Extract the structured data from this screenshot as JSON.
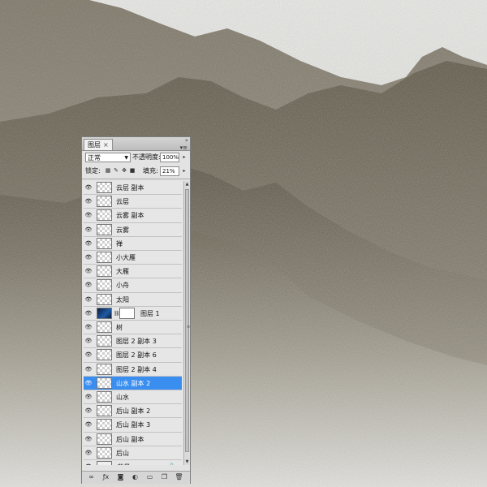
{
  "panel": {
    "tab_label": "图层",
    "tab_close": "×",
    "collapse_icon": "»",
    "menu_icon": "▾≡",
    "blend_mode": "正常",
    "opacity_label": "不透明度:",
    "opacity_value": "100%",
    "lock_label": "锁定:",
    "fill_label": "填充:",
    "fill_value": "21%"
  },
  "layers": [
    {
      "name": "云层 副本",
      "thumb": "checker"
    },
    {
      "name": "云层",
      "thumb": "checker"
    },
    {
      "name": "云雾 副本",
      "thumb": "checker"
    },
    {
      "name": "云雾",
      "thumb": "checker"
    },
    {
      "name": "禅",
      "thumb": "checker"
    },
    {
      "name": "小大雁",
      "thumb": "checker"
    },
    {
      "name": "大雁",
      "thumb": "checker"
    },
    {
      "name": "小舟",
      "thumb": "checker"
    },
    {
      "name": "太阳",
      "thumb": "checker"
    },
    {
      "name": "图层 1",
      "thumb": "sky",
      "mask": true
    },
    {
      "name": "树",
      "thumb": "checker"
    },
    {
      "name": "图层 2 副本 3",
      "thumb": "checker"
    },
    {
      "name": "图层 2 副本 6",
      "thumb": "checker"
    },
    {
      "name": "图层 2 副本 4",
      "thumb": "checker"
    },
    {
      "name": "山水 副本 2",
      "thumb": "checker",
      "selected": true
    },
    {
      "name": "山水",
      "thumb": "checker"
    },
    {
      "name": "后山 副本 2",
      "thumb": "checker"
    },
    {
      "name": "后山 副本 3",
      "thumb": "checker"
    },
    {
      "name": "后山 副本",
      "thumb": "checker"
    },
    {
      "name": "后山",
      "thumb": "checker"
    },
    {
      "name": "背景",
      "thumb": "plain",
      "italic": true,
      "locked": true
    }
  ],
  "bottom_icons": [
    "link-layers-icon",
    "fx-icon",
    "add-mask-icon",
    "adjustment-layer-icon",
    "new-group-icon",
    "new-layer-icon",
    "delete-layer-icon"
  ],
  "colors": {
    "selection": "#3a8ef0",
    "mountain": "#6e6656",
    "sky": "#dededb"
  }
}
